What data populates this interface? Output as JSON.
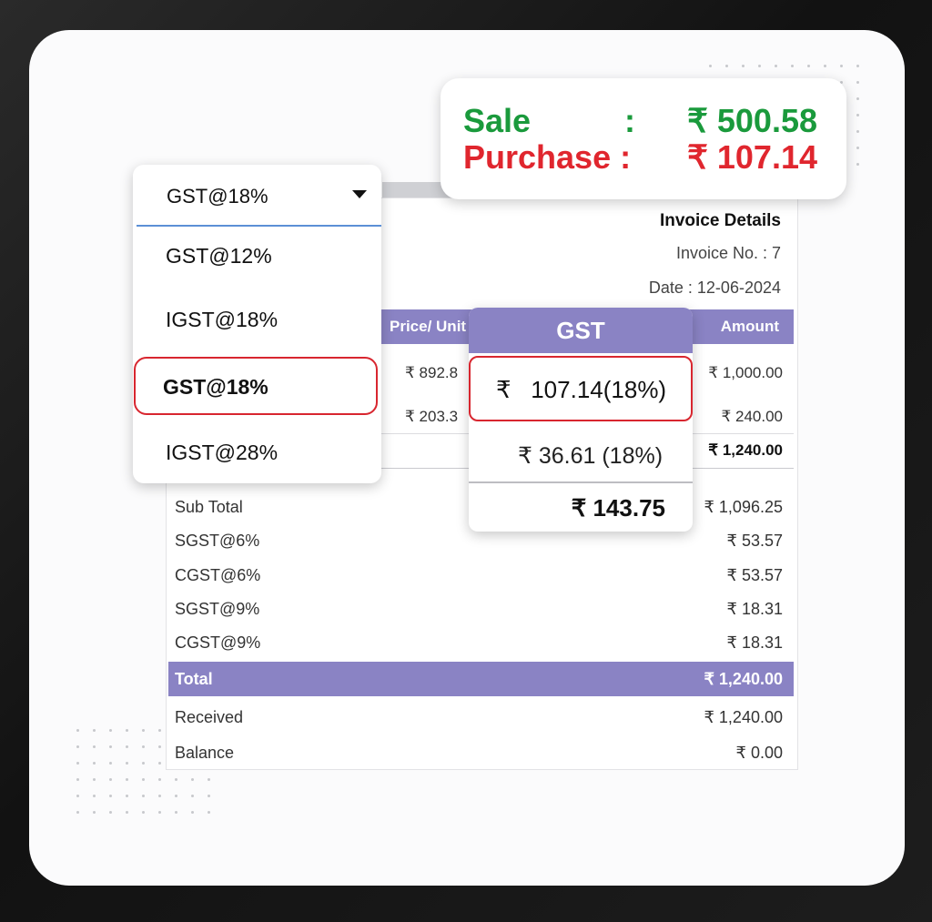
{
  "summary": {
    "sale_label": "Sale",
    "sale_colon": ":",
    "sale_value": "₹ 500.58",
    "purchase_label": "Purchase :",
    "purchase_value": "₹ 107.14",
    "colors": {
      "sale": "#1a9a3c",
      "purchase": "#e0262e"
    }
  },
  "dropdown": {
    "selected": "GST@18%",
    "options": [
      "GST@12%",
      "IGST@18%",
      "GST@18%",
      "IGST@28%"
    ],
    "highlighted_index": 2,
    "caret_icon": "caret-down-icon"
  },
  "invoice": {
    "title": "Invoice Details",
    "number": "Invoice No. : 7",
    "date": "Date : 12-06-2024",
    "columns": [
      "Price/ Unit",
      "GST",
      "Amount"
    ],
    "rows": [
      {
        "price": "₹ 892.8",
        "amount": "₹ 1,000.00"
      },
      {
        "price": "₹ 203.3",
        "amount": "₹ 240.00"
      }
    ],
    "items_total": "₹ 1,240.00",
    "summary": [
      {
        "label": "Sub Total",
        "value": "₹ 1,096.25"
      },
      {
        "label": "SGST@6%",
        "value": "₹ 53.57"
      },
      {
        "label": "CGST@6%",
        "value": "₹ 53.57"
      },
      {
        "label": "SGST@9%",
        "value": "₹ 18.31"
      },
      {
        "label": "CGST@9%",
        "value": "₹ 18.31"
      }
    ],
    "total_label": "Total",
    "total_value": "₹ 1,240.00",
    "received_label": "Received",
    "received_value": "₹ 1,240.00",
    "balance_label": "Balance",
    "balance_value": "₹ 0.00",
    "accent": "#8a83c4"
  },
  "gst_popup": {
    "header": "GST",
    "row1": "₹   107.14(18%)",
    "row2": "₹ 36.61 (18%)",
    "total": "₹ 143.75"
  }
}
